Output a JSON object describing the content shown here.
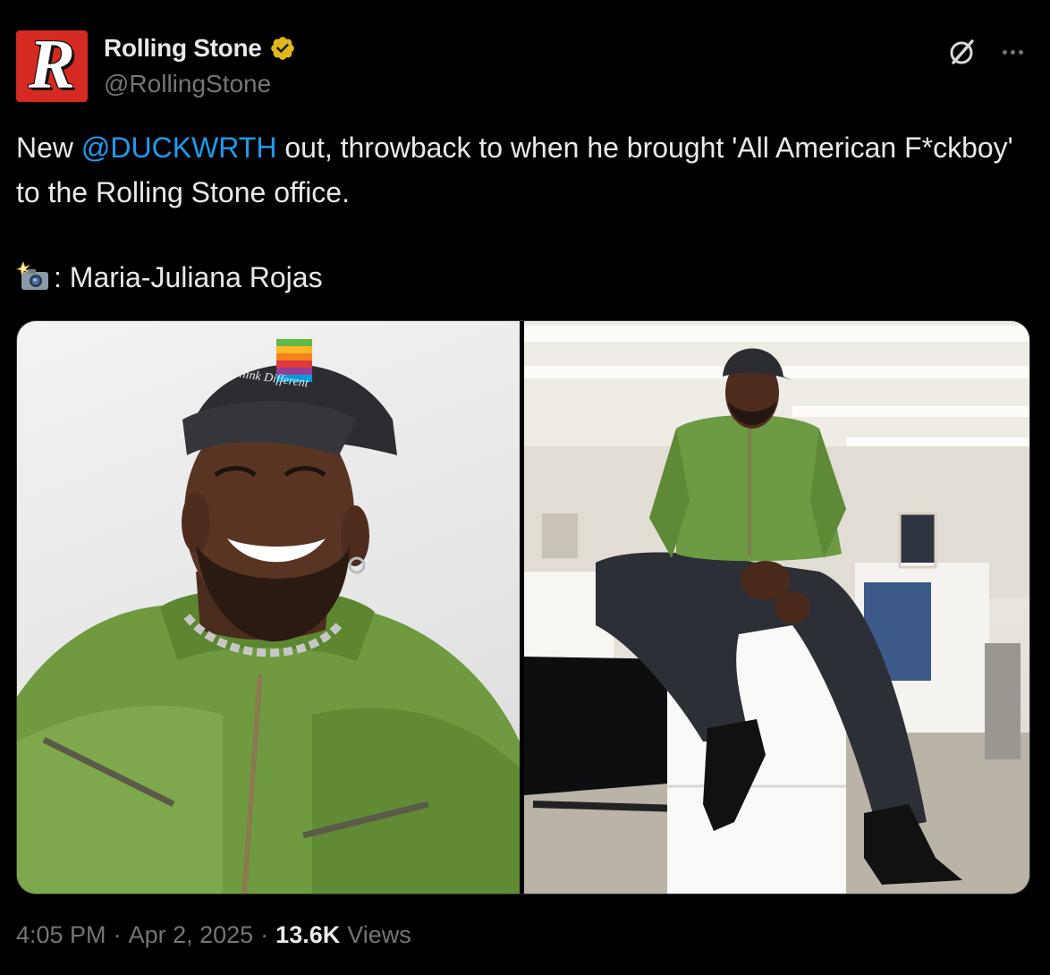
{
  "author": {
    "display_name": "Rolling Stone",
    "handle": "@RollingStone",
    "avatar_letter": "R",
    "verified_color": "#e2b719"
  },
  "tweet": {
    "text_before_mention": "New ",
    "mention": "@DUCKWRTH",
    "text_after_mention": " out, throwback to when he brought 'All American F*ckboy' to the Rolling Stone office.",
    "caption_label": ": Maria-Juliana Rojas"
  },
  "media": {
    "photo_left_hat_text": "Think Different"
  },
  "footer": {
    "time": "4:05 PM",
    "sep1": "·",
    "date": "Apr 2, 2025",
    "sep2": "·",
    "views_count": "13.6K",
    "views_label": "Views"
  },
  "colors": {
    "accent": "#1d9bf0",
    "muted": "#71767b",
    "background": "#000000",
    "brand_red": "#d42a22"
  },
  "icons": {
    "grok": "grok-icon",
    "more": "more-icon",
    "camera": "camera-flash-icon",
    "verified": "verified-badge-icon"
  }
}
